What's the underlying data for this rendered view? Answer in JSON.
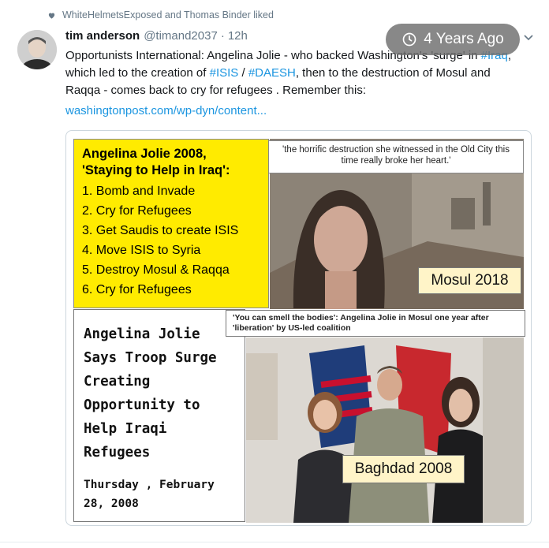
{
  "liked_bar": {
    "icon": "heart-icon",
    "text": "WhiteHelmetsExposed and Thomas Binder liked"
  },
  "tweet": {
    "author_name": "tim anderson",
    "handle": "@timand2037",
    "separator": "·",
    "time": "12h",
    "text_parts": {
      "p1": "Opportunists International: Angelina Jolie - who backed Washington's 'surge' in ",
      "tag_iraq": "#Iraq",
      "p2": ", which led to the creation of ",
      "tag_isis": "#ISIS",
      "p3": " / ",
      "tag_daesh": "#DAESH",
      "p4": ", then to the destruction of Mosul and Raqqa - comes back to cry for refugees . Remember this:"
    },
    "link": "washingtonpost.com/wp-dyn/content..."
  },
  "age_badge": {
    "icon": "clock-icon",
    "label": "4 Years Ago"
  },
  "menu_icon": "chevron-down-icon",
  "meme": {
    "yellow_box": {
      "title_line1": "Angelina Jolie 2008,",
      "title_line2": "'Staying to Help in Iraq':",
      "items": [
        "1. Bomb and Invade",
        "2. Cry for Refugees",
        "3. Get Saudis to create ISIS",
        "4. Move ISIS to Syria",
        "5. Destroy Mosul & Raqqa",
        "6. Cry for Refugees"
      ]
    },
    "quote_top": "'the horrific destruction she witnessed in the Old City this time really broke her heart.'",
    "label_mosul": "Mosul 2018",
    "quote_bottom": "'You can smell the bodies': Angelina Jolie in Mosul one year after 'liberation' by US-led coalition",
    "headline": {
      "lines": [
        "Angelina Jolie",
        "Says Troop Surge",
        "Creating",
        "Opportunity to",
        "Help Iraqi",
        "Refugees"
      ],
      "date_line1": "Thursday , February",
      "date_line2": "28, 2008"
    },
    "label_baghdad": "Baghdad 2008"
  },
  "colors": {
    "link_blue": "#1b95e0",
    "muted_gray": "#657786",
    "meme_yellow": "#ffeb00",
    "label_cream": "#fff4c8"
  }
}
